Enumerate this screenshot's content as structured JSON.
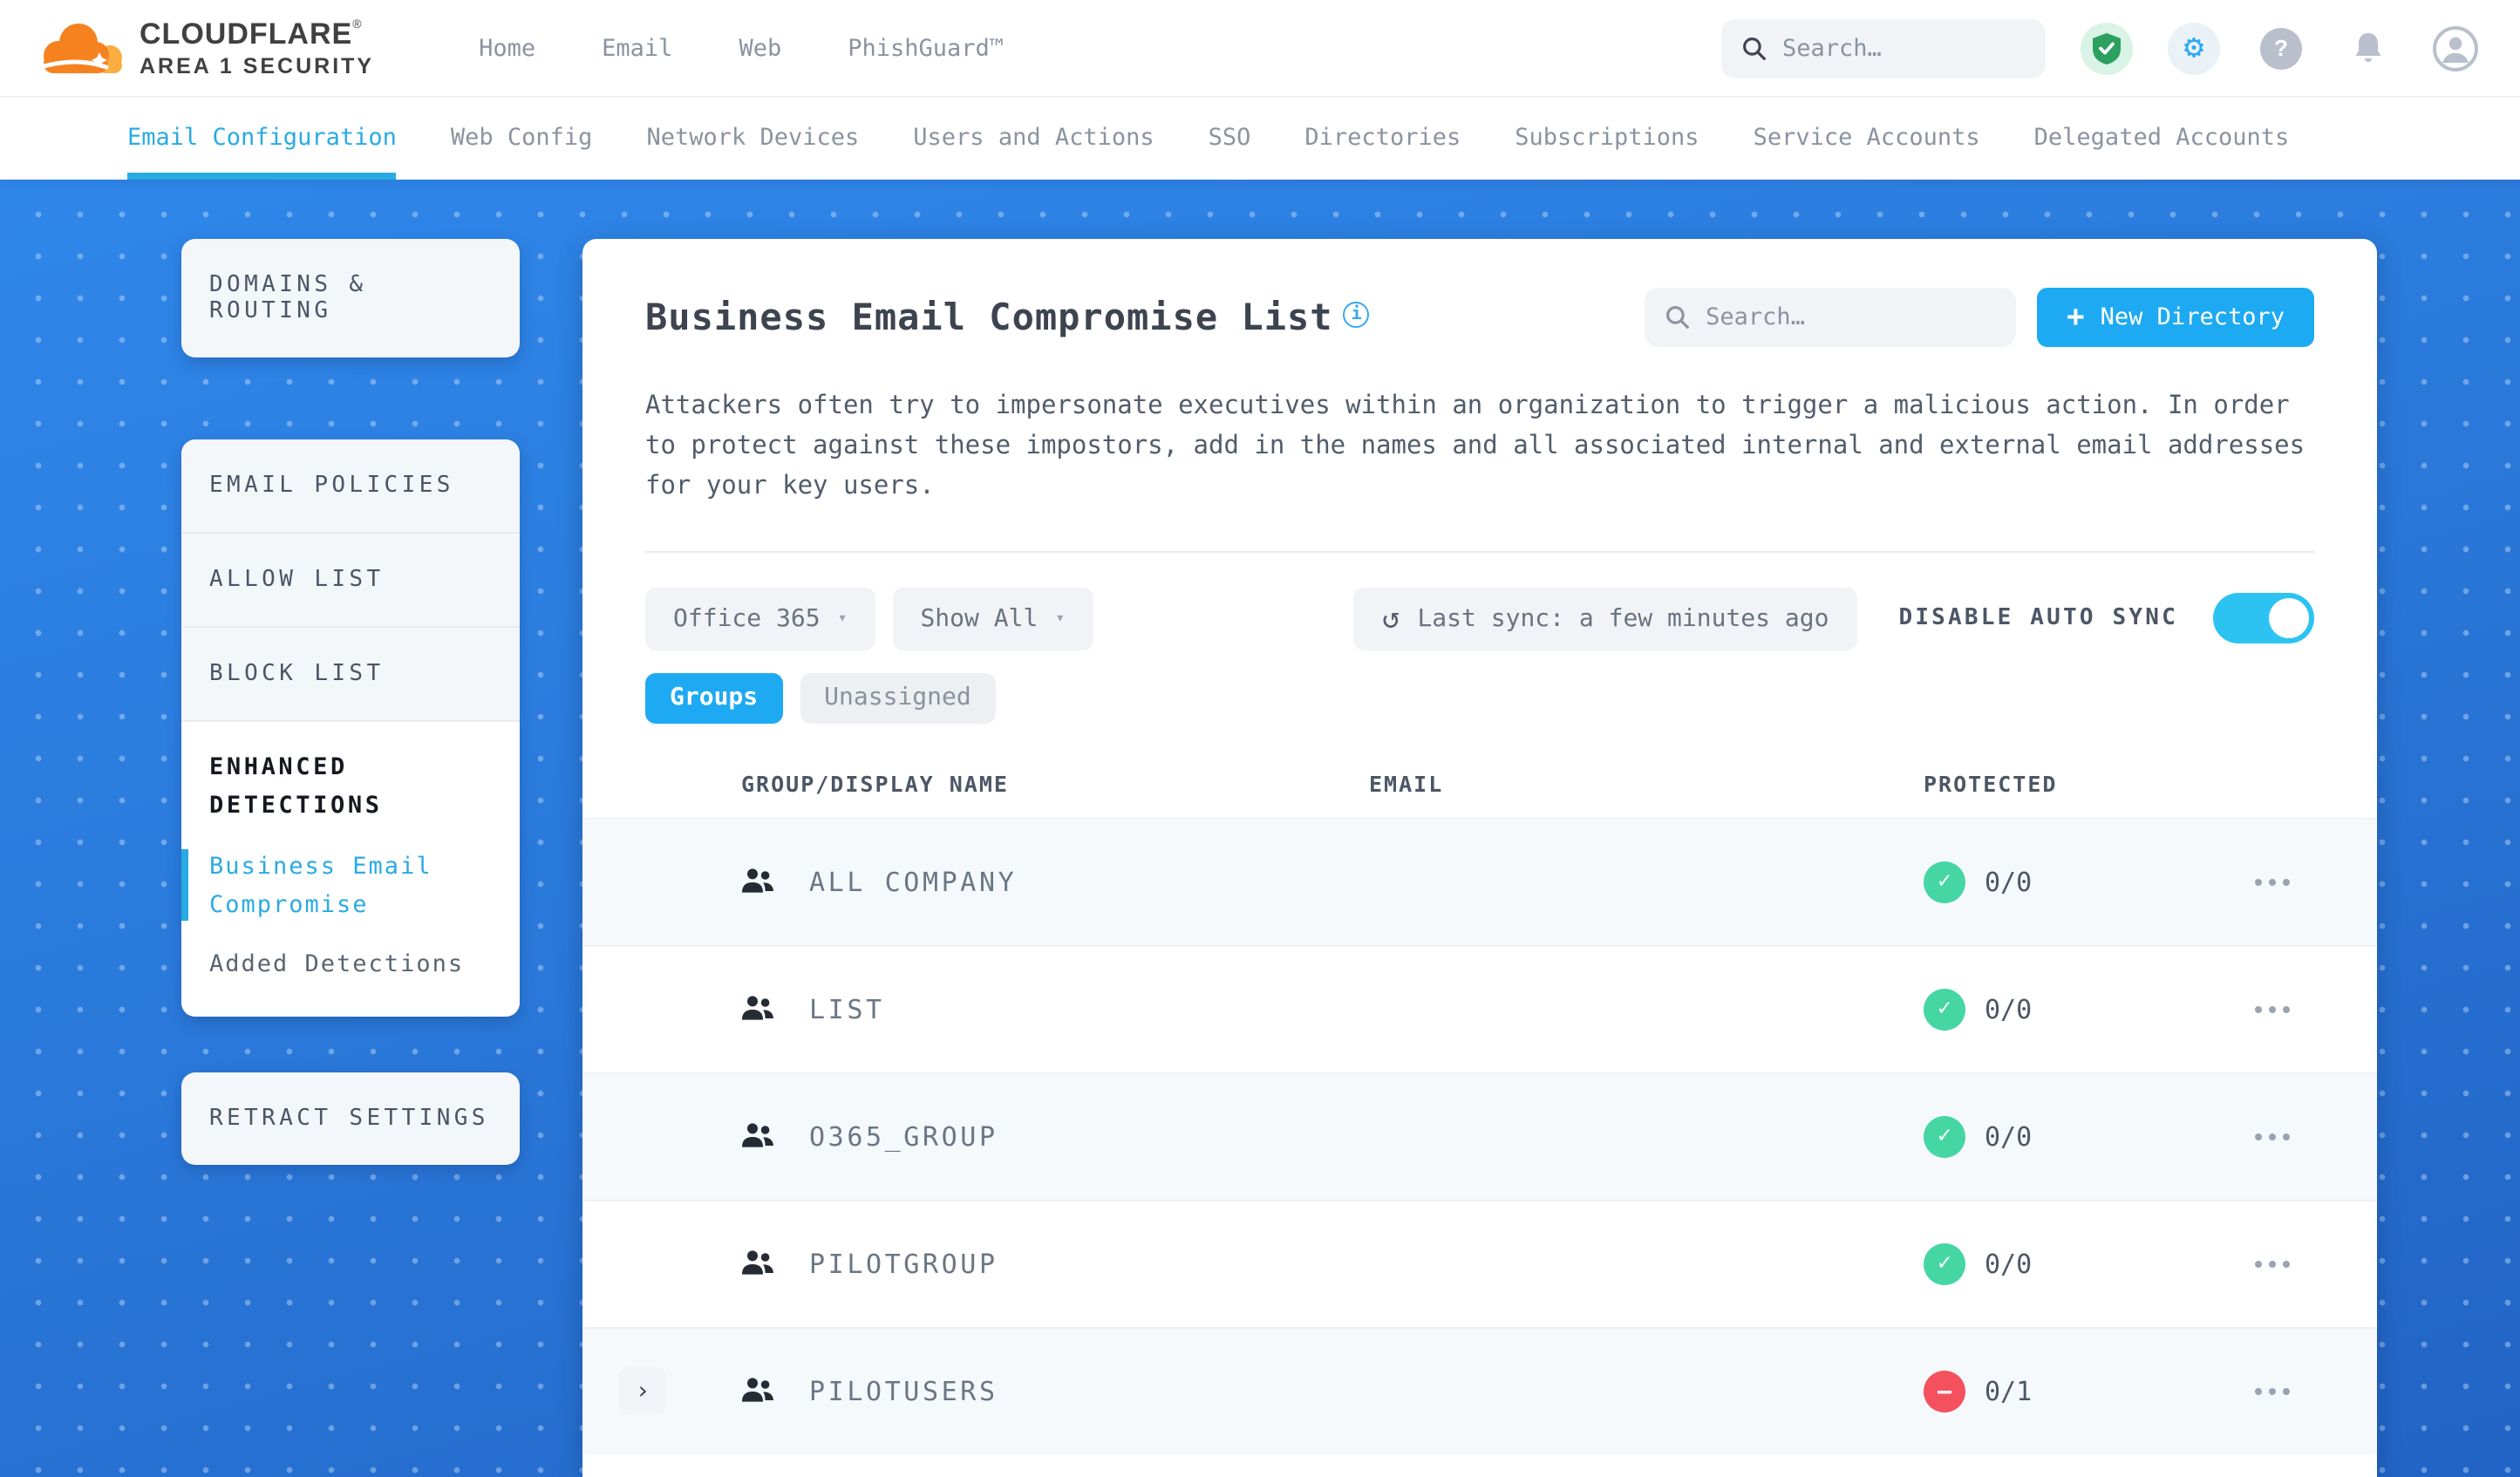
{
  "header": {
    "logo_brand": "CLOUDFLARE",
    "logo_mark": "®",
    "logo_sub": "AREA 1 SECURITY",
    "nav": {
      "home": "Home",
      "email": "Email",
      "web": "Web",
      "phishguard": "PhishGuard™"
    },
    "search_placeholder": "Search…",
    "icons": [
      "shield-check",
      "settings-gear",
      "help",
      "notifications-bell",
      "account-avatar"
    ]
  },
  "subnav": {
    "tabs": [
      {
        "label": "Email Configuration",
        "active": true
      },
      {
        "label": "Web Config",
        "active": false
      },
      {
        "label": "Network Devices",
        "active": false
      },
      {
        "label": "Users and Actions",
        "active": false
      },
      {
        "label": "SSO",
        "active": false
      },
      {
        "label": "Directories",
        "active": false
      },
      {
        "label": "Subscriptions",
        "active": false
      },
      {
        "label": "Service Accounts",
        "active": false
      },
      {
        "label": "Delegated Accounts",
        "active": false
      }
    ]
  },
  "sidebar": {
    "domains_routing": "DOMAINS & ROUTING",
    "email_policies": "EMAIL POLICIES",
    "allow_list": "ALLOW LIST",
    "block_list": "BLOCK LIST",
    "enhanced_detections": "ENHANCED DETECTIONS",
    "business_email_compromise": "Business Email Compromise",
    "added_detections": "Added Detections",
    "retract_settings": "RETRACT SETTINGS"
  },
  "main": {
    "title": "Business Email Compromise List",
    "info_icon": "i",
    "search_placeholder": "Search…",
    "new_directory_label": "New Directory",
    "description": "Attackers often try to impersonate executives within an organization to trigger a malicious action. In order to protect against these impostors, add in the names and all associated internal and external email addresses for your key users.",
    "directory_filter": "Office 365",
    "show_filter": "Show All",
    "last_sync_label": "Last sync: a few minutes ago",
    "auto_sync_label": "DISABLE AUTO SYNC",
    "auto_sync_enabled": true,
    "group_tab": "Groups",
    "unassigned_tab": "Unassigned",
    "table": {
      "columns": {
        "name": "GROUP/DISPLAY NAME",
        "email": "EMAIL",
        "protected": "PROTECTED"
      },
      "rows": [
        {
          "name": "ALL COMPANY",
          "email": "",
          "protected": "0/0",
          "status": "protected",
          "expandable": false
        },
        {
          "name": "LIST",
          "email": "",
          "protected": "0/0",
          "status": "protected",
          "expandable": false
        },
        {
          "name": "O365_GROUP",
          "email": "",
          "protected": "0/0",
          "status": "protected",
          "expandable": false
        },
        {
          "name": "PILOTGROUP",
          "email": "",
          "protected": "0/0",
          "status": "protected",
          "expandable": false
        },
        {
          "name": "PILOTUSERS",
          "email": "",
          "protected": "0/1",
          "status": "blocked",
          "expandable": true
        }
      ]
    }
  },
  "icons": {
    "plus": "+",
    "caret_down": "▾",
    "refresh": "↺",
    "check": "✓",
    "minus": "−",
    "chevron_right": "›",
    "question": "?"
  },
  "colors": {
    "accent": "#1daaf2",
    "active_tab": "#29abe2",
    "success": "#45d6a3",
    "danger": "#f4505e",
    "toggle_on": "#2cc3f2",
    "background_blue": "#2a79da"
  }
}
